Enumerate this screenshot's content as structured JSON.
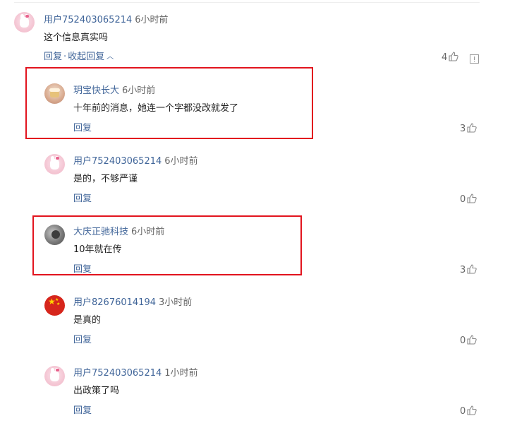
{
  "comment_main": {
    "username": "用户752403065214",
    "time": "6小时前",
    "text": "这个信息真实吗",
    "reply_label": "回复",
    "separator": "·",
    "collapse_label": "收起回复",
    "likes": "4"
  },
  "replies": [
    {
      "username": "玥宝快长大",
      "time": "6小时前",
      "text": "十年前的消息，她连一个字都没改就发了",
      "reply_label": "回复",
      "likes": "3"
    },
    {
      "username": "用户752403065214",
      "time": "6小时前",
      "text": "是的，不够严谨",
      "reply_label": "回复",
      "likes": "0"
    },
    {
      "username": "大庆正驰科技",
      "time": "6小时前",
      "text": "10年就在传",
      "reply_label": "回复",
      "likes": "3"
    },
    {
      "username": "用户82676014194",
      "time": "3小时前",
      "text": "是真的",
      "reply_label": "回复",
      "likes": "0"
    },
    {
      "username": "用户752403065214",
      "time": "1小时前",
      "text": "出政策了吗",
      "reply_label": "回复",
      "likes": "0"
    }
  ],
  "colors": {
    "link": "#406599",
    "highlight_box": "#e2141e",
    "time": "#666666"
  }
}
